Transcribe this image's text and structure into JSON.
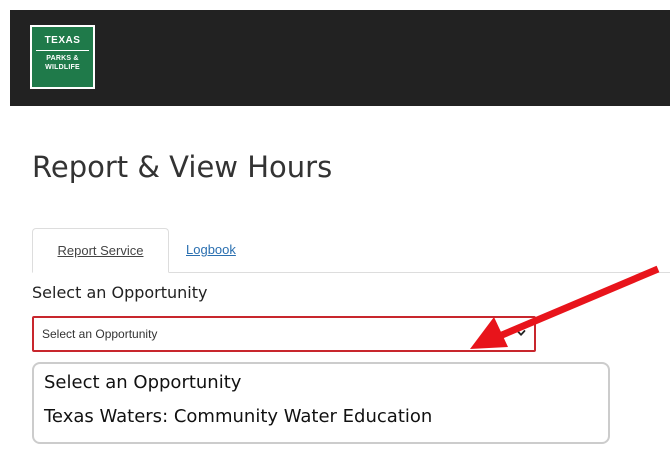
{
  "header": {
    "logo": {
      "line1": "TEXAS",
      "line2": "PARKS &",
      "line3": "WILDLIFE"
    }
  },
  "main": {
    "title": "Report & View Hours",
    "tabs": [
      {
        "label": "Report Service",
        "active": true
      },
      {
        "label": "Logbook",
        "active": false
      }
    ],
    "select": {
      "label": "Select an Opportunity",
      "value": "Select an Opportunity",
      "options": [
        "Select an Opportunity",
        "Texas Waters: Community Water Education"
      ]
    }
  },
  "colors": {
    "header_bg": "#222222",
    "logo_green": "#1f7a4a",
    "select_border": "#c8262d",
    "link": "#2a6fb0",
    "annotation_arrow": "#e8141b"
  },
  "icons": {
    "select_caret": "chevron-down-icon",
    "annotation": "red-arrow-icon"
  }
}
